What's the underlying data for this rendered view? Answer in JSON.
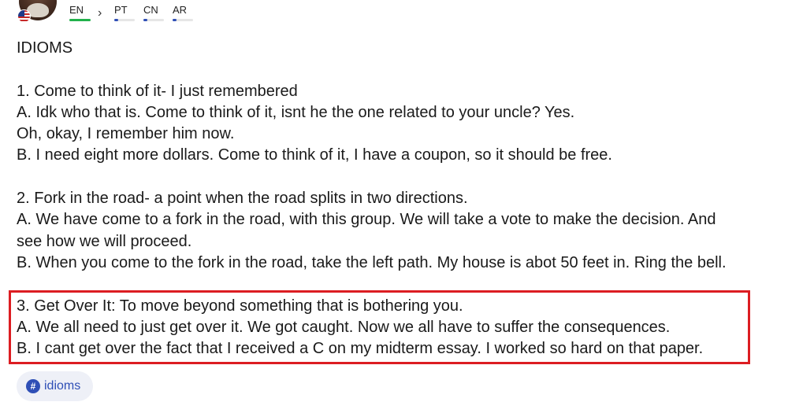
{
  "languages": [
    {
      "code": "EN",
      "progress": 1.0,
      "color": "#22b14c"
    },
    {
      "code": "PT",
      "progress": 0.15,
      "color": "#2f4fb6"
    },
    {
      "code": "CN",
      "progress": 0.15,
      "color": "#2f4fb6"
    },
    {
      "code": "AR",
      "progress": 0.15,
      "color": "#2f4fb6"
    }
  ],
  "post": {
    "heading": "IDIOMS",
    "lines": [
      "1. Come to think of it- I just remembered",
      "A. Idk who that is. Come to think of it, isnt he the one related to your uncle? Yes.",
      "Oh, okay, I remember him now.",
      "B. I need eight more dollars. Come to think of it, I have a coupon, so it should be free.",
      "2. Fork in the road- a point when the road splits in two directions.",
      "A. We have come to a fork in the road, with this group. We will take a vote to make the decision. And",
      "see how we will proceed.",
      "B. When you come to the fork in the road, take the left path. My house is abot 50 feet in. Ring the bell.",
      "3. Get Over It: To move beyond something that is bothering you.",
      "A. We all need to just get over it. We got caught. Now we all have to suffer the consequences.",
      "B. I cant get over the fact that I received a C on my midterm essay. I worked so hard on that paper."
    ]
  },
  "tag": {
    "icon": "hashtag-icon",
    "label": "idioms"
  },
  "highlight_color": "#dc1d22"
}
